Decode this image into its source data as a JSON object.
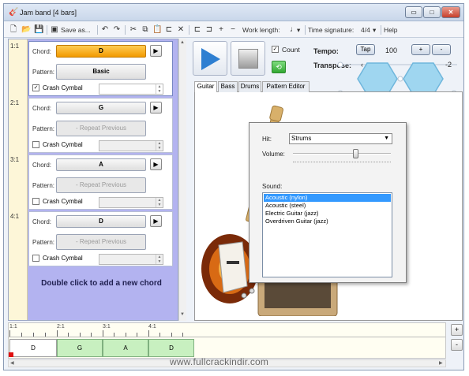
{
  "window": {
    "title": "Jam band [4 bars]",
    "controls": {
      "minimize": "▭",
      "maximize": "□",
      "close": "✕"
    }
  },
  "toolbar": {
    "save_as_label": "Save as...",
    "work_length_label": "Work length:",
    "work_length_value": "♩",
    "time_signature_label": "Time signature:",
    "time_signature_value": "4/4",
    "help_label": "Help"
  },
  "chords": [
    {
      "bar": "1:1",
      "chord_label": "Chord:",
      "chord": "D",
      "pattern_label": "Pattern:",
      "pattern": "Basic",
      "crash_label": "Crash Cymbal",
      "crash_checked": true,
      "selected": true
    },
    {
      "bar": "2:1",
      "chord_label": "Chord:",
      "chord": "G",
      "pattern_label": "Pattern:",
      "pattern": "- Repeat Previous",
      "crash_label": "Crash Cymbal",
      "crash_checked": false,
      "selected": false
    },
    {
      "bar": "3:1",
      "chord_label": "Chord:",
      "chord": "A",
      "pattern_label": "Pattern:",
      "pattern": "- Repeat Previous",
      "crash_label": "Crash Cymbal",
      "crash_checked": false,
      "selected": false
    },
    {
      "bar": "4:1",
      "chord_label": "Chord:",
      "chord": "D",
      "pattern_label": "Pattern:",
      "pattern": "- Repeat Previous",
      "crash_label": "Crash Cymbal",
      "crash_checked": false,
      "selected": false
    }
  ],
  "add_chord_hint": "Double click to add a new chord",
  "transport": {
    "count_label": "Count",
    "count_checked": true,
    "tempo_label": "Tempo:",
    "tap_label": "Tap",
    "tempo_value": "100",
    "tempo_plus": "+",
    "tempo_minus": "-",
    "transpose_label": "Transpose:",
    "transpose_value": "-2"
  },
  "tabs": [
    "Guitar",
    "Bass",
    "Drums",
    "Pattern Editor"
  ],
  "active_tab": "Guitar",
  "instrument_dialog": {
    "hit_label": "Hit:",
    "hit_value": "Strums",
    "volume_label": "Volume:",
    "volume_fraction": 0.65,
    "sound_label": "Sound:",
    "sounds": [
      "Acoustic (nylon)",
      "Acoustic (steel)",
      "Electric Guitar (jazz)",
      "Overdriven Guitar (jazz)"
    ],
    "selected_sound": "Acoustic (nylon)"
  },
  "timeline": {
    "markers": [
      "1:1",
      "2:1",
      "3:1",
      "4:1"
    ],
    "blocks": [
      "D",
      "G",
      "A",
      "D"
    ],
    "zoom_in": "+",
    "zoom_out": "-"
  },
  "watermark": "www.fullcrackindir.com",
  "colors": {
    "selected_chord": "#f5a623",
    "chord_list_bg": "#b3b3f0",
    "timeline_block": "#c8f0c0",
    "play_button": "#2e7fd1",
    "hexagon": "#9fd6f0"
  }
}
